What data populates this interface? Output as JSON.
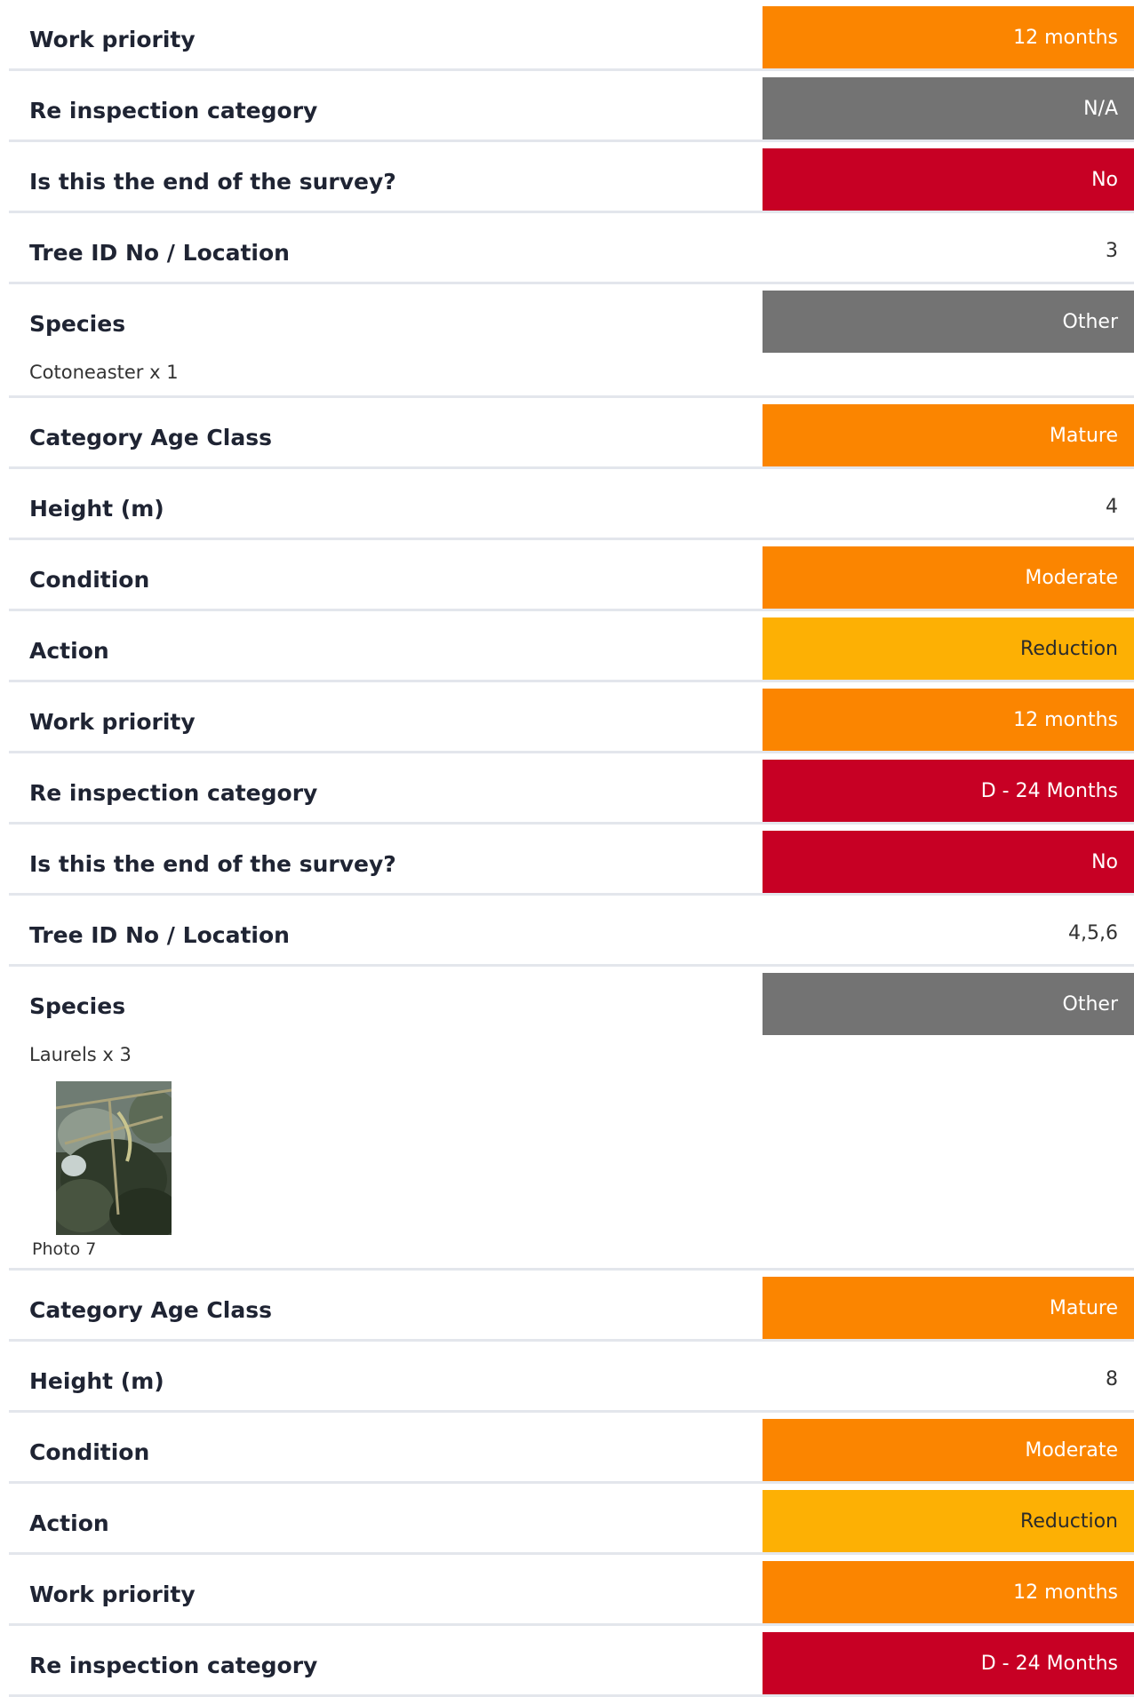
{
  "rows": [
    {
      "label": "Work priority",
      "value": "12 months",
      "style": "orange"
    },
    {
      "label": "Re inspection category",
      "value": "N/A",
      "style": "grey"
    },
    {
      "label": "Is this the end of the survey?",
      "value": "No",
      "style": "red"
    },
    {
      "label": "Tree ID No / Location",
      "value": "3",
      "style": "plain"
    },
    {
      "label": "Species",
      "value": "Other",
      "style": "grey",
      "note": "Cotoneaster x 1"
    },
    {
      "label": "Category Age Class",
      "value": "Mature",
      "style": "orange"
    },
    {
      "label": "Height (m)",
      "value": "4",
      "style": "plain"
    },
    {
      "label": "Condition",
      "value": "Moderate",
      "style": "orange"
    },
    {
      "label": "Action",
      "value": "Reduction",
      "style": "amber"
    },
    {
      "label": "Work priority",
      "value": "12 months",
      "style": "orange"
    },
    {
      "label": "Re inspection category",
      "value": "D - 24 Months",
      "style": "red"
    },
    {
      "label": "Is this the end of the survey?",
      "value": "No",
      "style": "red"
    },
    {
      "label": "Tree ID No / Location",
      "value": "4,5,6",
      "style": "plain"
    },
    {
      "label": "Species",
      "value": "Other",
      "style": "grey",
      "note": "Laurels x 3",
      "photo": {
        "caption": "Photo 7",
        "subject": "tree-foliage-photo"
      }
    },
    {
      "label": "Category Age Class",
      "value": "Mature",
      "style": "orange"
    },
    {
      "label": "Height (m)",
      "value": "8",
      "style": "plain"
    },
    {
      "label": "Condition",
      "value": "Moderate",
      "style": "orange"
    },
    {
      "label": "Action",
      "value": "Reduction",
      "style": "amber"
    },
    {
      "label": "Work priority",
      "value": "12 months",
      "style": "orange"
    },
    {
      "label": "Re inspection category",
      "value": "D - 24 Months",
      "style": "red"
    }
  ],
  "colors": {
    "orange": "#fb8500",
    "grey": "#737373",
    "red": "#c70024",
    "amber": "#fdb004",
    "divider": "#e3e6ec"
  }
}
